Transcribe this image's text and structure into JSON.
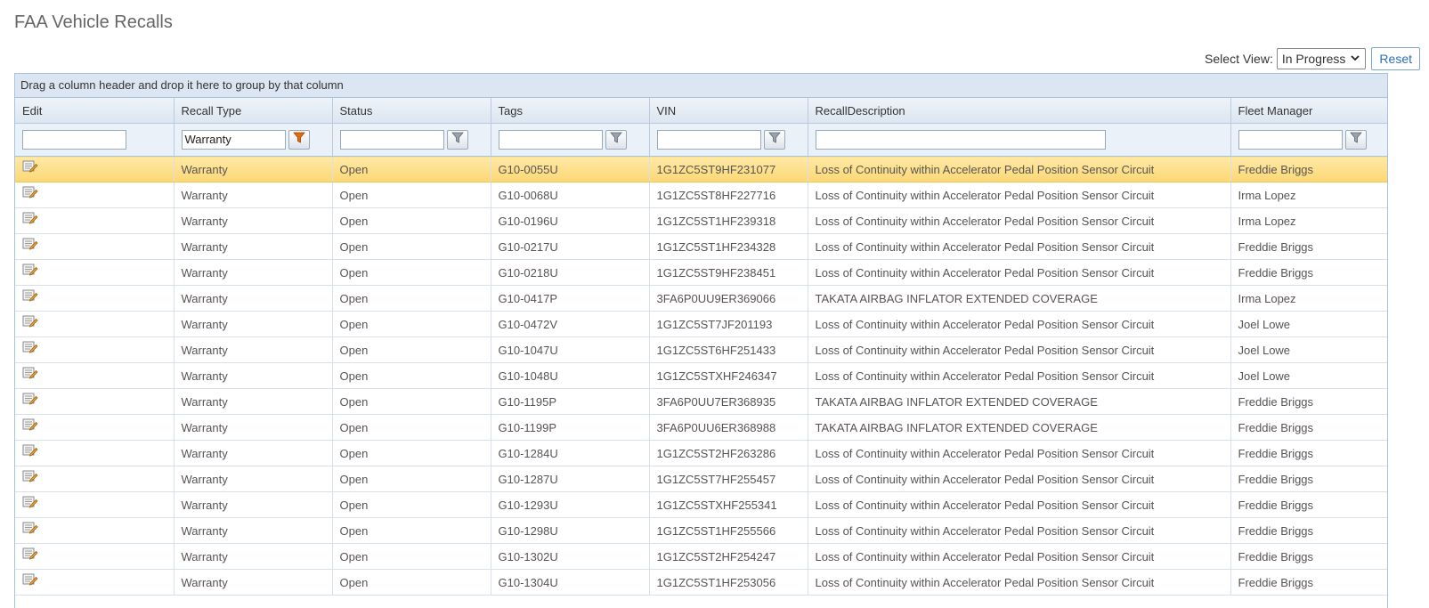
{
  "page": {
    "title": "FAA Vehicle Recalls"
  },
  "toolbar": {
    "select_view_label": "Select View:",
    "select_view_value": "In Progress",
    "reset_label": "Reset"
  },
  "grid": {
    "group_panel_text": "Drag a column header and drop it here to group by that column",
    "columns": [
      "Edit",
      "Recall Type",
      "Status",
      "Tags",
      "VIN",
      "RecallDescription",
      "Fleet Manager"
    ],
    "filters": {
      "edit": "",
      "recall_type": "Warranty",
      "status": "",
      "tags": "",
      "vin": "",
      "recall_description": "",
      "fleet_manager": ""
    },
    "active_filter_color": "#e36c09",
    "selected_row_color": "#fcd774",
    "rows": [
      {
        "recall_type": "Warranty",
        "status": "Open",
        "tags": "G10-0055U",
        "vin": "1G1ZC5ST9HF231077",
        "description": "Loss of Continuity within Accelerator Pedal Position Sensor Circuit",
        "fleet_manager": "Freddie Briggs",
        "selected": true
      },
      {
        "recall_type": "Warranty",
        "status": "Open",
        "tags": "G10-0068U",
        "vin": "1G1ZC5ST8HF227716",
        "description": "Loss of Continuity within Accelerator Pedal Position Sensor Circuit",
        "fleet_manager": "Irma Lopez"
      },
      {
        "recall_type": "Warranty",
        "status": "Open",
        "tags": "G10-0196U",
        "vin": "1G1ZC5ST1HF239318",
        "description": "Loss of Continuity within Accelerator Pedal Position Sensor Circuit",
        "fleet_manager": "Irma Lopez"
      },
      {
        "recall_type": "Warranty",
        "status": "Open",
        "tags": "G10-0217U",
        "vin": "1G1ZC5ST1HF234328",
        "description": "Loss of Continuity within Accelerator Pedal Position Sensor Circuit",
        "fleet_manager": "Freddie Briggs"
      },
      {
        "recall_type": "Warranty",
        "status": "Open",
        "tags": "G10-0218U",
        "vin": "1G1ZC5ST9HF238451",
        "description": "Loss of Continuity within Accelerator Pedal Position Sensor Circuit",
        "fleet_manager": "Freddie Briggs"
      },
      {
        "recall_type": "Warranty",
        "status": "Open",
        "tags": "G10-0417P",
        "vin": "3FA6P0UU9ER369066",
        "description": "TAKATA AIRBAG INFLATOR EXTENDED COVERAGE",
        "fleet_manager": "Irma Lopez"
      },
      {
        "recall_type": "Warranty",
        "status": "Open",
        "tags": "G10-0472V",
        "vin": "1G1ZC5ST7JF201193",
        "description": "Loss of Continuity within Accelerator Pedal Position Sensor Circuit",
        "fleet_manager": "Joel Lowe"
      },
      {
        "recall_type": "Warranty",
        "status": "Open",
        "tags": "G10-1047U",
        "vin": "1G1ZC5ST6HF251433",
        "description": "Loss of Continuity within Accelerator Pedal Position Sensor Circuit",
        "fleet_manager": "Joel Lowe"
      },
      {
        "recall_type": "Warranty",
        "status": "Open",
        "tags": "G10-1048U",
        "vin": "1G1ZC5STXHF246347",
        "description": "Loss of Continuity within Accelerator Pedal Position Sensor Circuit",
        "fleet_manager": "Joel Lowe"
      },
      {
        "recall_type": "Warranty",
        "status": "Open",
        "tags": "G10-1195P",
        "vin": "3FA6P0UU7ER368935",
        "description": "TAKATA AIRBAG INFLATOR EXTENDED COVERAGE",
        "fleet_manager": "Freddie Briggs"
      },
      {
        "recall_type": "Warranty",
        "status": "Open",
        "tags": "G10-1199P",
        "vin": "3FA6P0UU6ER368988",
        "description": "TAKATA AIRBAG INFLATOR EXTENDED COVERAGE",
        "fleet_manager": "Freddie Briggs"
      },
      {
        "recall_type": "Warranty",
        "status": "Open",
        "tags": "G10-1284U",
        "vin": "1G1ZC5ST2HF263286",
        "description": "Loss of Continuity within Accelerator Pedal Position Sensor Circuit",
        "fleet_manager": "Freddie Briggs"
      },
      {
        "recall_type": "Warranty",
        "status": "Open",
        "tags": "G10-1287U",
        "vin": "1G1ZC5ST7HF255457",
        "description": "Loss of Continuity within Accelerator Pedal Position Sensor Circuit",
        "fleet_manager": "Freddie Briggs"
      },
      {
        "recall_type": "Warranty",
        "status": "Open",
        "tags": "G10-1293U",
        "vin": "1G1ZC5STXHF255341",
        "description": "Loss of Continuity within Accelerator Pedal Position Sensor Circuit",
        "fleet_manager": "Freddie Briggs"
      },
      {
        "recall_type": "Warranty",
        "status": "Open",
        "tags": "G10-1298U",
        "vin": "1G1ZC5ST1HF255566",
        "description": "Loss of Continuity within Accelerator Pedal Position Sensor Circuit",
        "fleet_manager": "Freddie Briggs"
      },
      {
        "recall_type": "Warranty",
        "status": "Open",
        "tags": "G10-1302U",
        "vin": "1G1ZC5ST2HF254247",
        "description": "Loss of Continuity within Accelerator Pedal Position Sensor Circuit",
        "fleet_manager": "Freddie Briggs"
      },
      {
        "recall_type": "Warranty",
        "status": "Open",
        "tags": "G10-1304U",
        "vin": "1G1ZC5ST1HF253056",
        "description": "Loss of Continuity within Accelerator Pedal Position Sensor Circuit",
        "fleet_manager": "Freddie Briggs"
      }
    ]
  }
}
